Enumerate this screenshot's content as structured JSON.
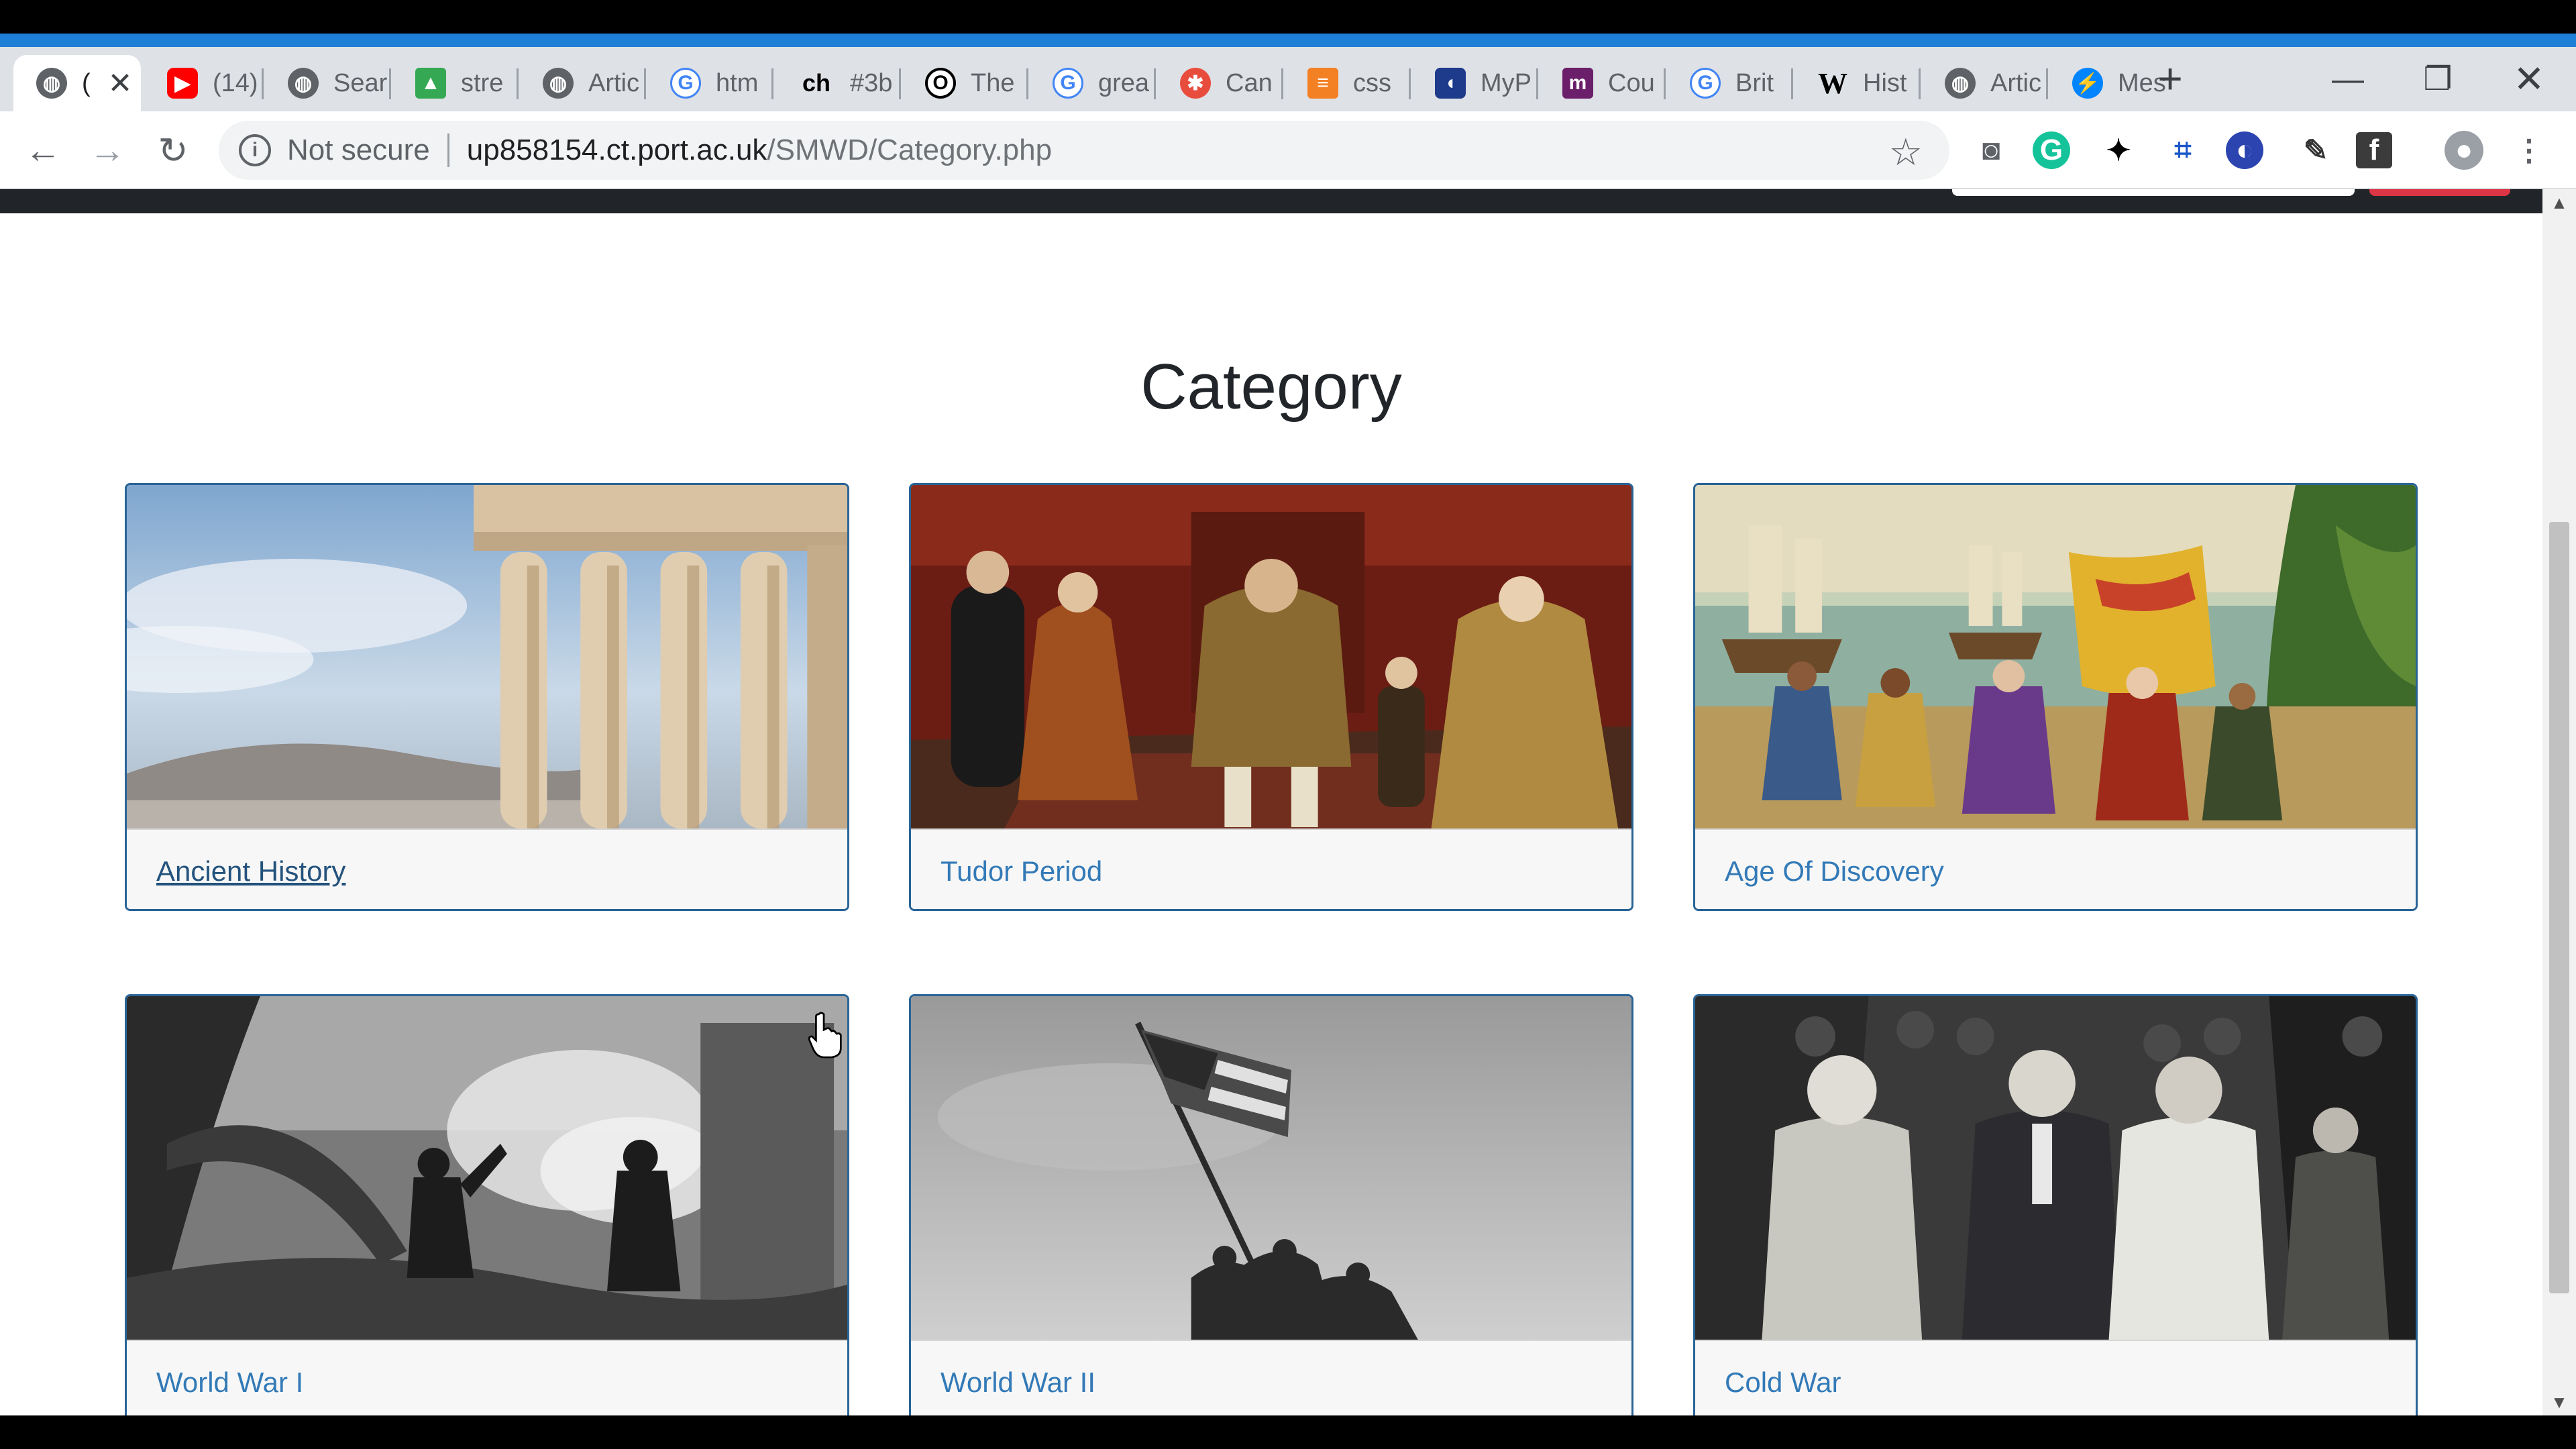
{
  "browser": {
    "tabs": [
      {
        "title": "(",
        "icon": "globe-icon",
        "icon_color": "#5f6368",
        "active": true
      },
      {
        "title": "(14)",
        "icon": "youtube-icon",
        "icon_color": "#ff0000"
      },
      {
        "title": "Sear",
        "icon": "globe-icon",
        "icon_color": "#5f6368"
      },
      {
        "title": "stre",
        "icon": "google-drive-icon",
        "icon_color": "#34a853"
      },
      {
        "title": "Artic",
        "icon": "globe-icon",
        "icon_color": "#5f6368"
      },
      {
        "title": "htm",
        "icon": "google-icon",
        "icon_color": "#4285f4"
      },
      {
        "title": "#3b",
        "icon": "ch-icon",
        "icon_color": "#000000"
      },
      {
        "title": "The",
        "icon": "opera-icon",
        "icon_color": "#000000"
      },
      {
        "title": "grea",
        "icon": "google-icon",
        "icon_color": "#4285f4"
      },
      {
        "title": "Can",
        "icon": "canva-icon",
        "icon_color": "#e84c3d"
      },
      {
        "title": "css",
        "icon": "stackoverflow-icon",
        "icon_color": "#f48024"
      },
      {
        "title": "MyP",
        "icon": "myportal-icon",
        "icon_color": "#1e3a8a"
      },
      {
        "title": "Cou",
        "icon": "m-logo-icon",
        "icon_color": "#6b1f6b"
      },
      {
        "title": "Brit",
        "icon": "google-icon",
        "icon_color": "#4285f4"
      },
      {
        "title": "Hist",
        "icon": "wikipedia-icon",
        "icon_color": "#000000"
      },
      {
        "title": "Artic",
        "icon": "globe-icon",
        "icon_color": "#5f6368"
      },
      {
        "title": "Mes",
        "icon": "messenger-icon",
        "icon_color": "#0084ff"
      }
    ],
    "not_secure": "Not secure",
    "url_host": "up858154.ct.port.ac.uk",
    "url_path": "/SMWD/Category.php"
  },
  "page": {
    "heading": "Category",
    "categories": [
      {
        "label": "Ancient History",
        "image": "caryatids-acropolis"
      },
      {
        "label": "Tudor Period",
        "image": "tudor-family-portrait"
      },
      {
        "label": "Age Of Discovery",
        "image": "columbus-landing"
      },
      {
        "label": "World War I",
        "image": "ww1-soldiers"
      },
      {
        "label": "World War II",
        "image": "iwo-jima-flag"
      },
      {
        "label": "Cold War",
        "image": "potsdam-leaders"
      }
    ]
  },
  "colors": {
    "accent": "#1e7fd6",
    "link": "#337ab7",
    "card_border": "#2a6496"
  }
}
